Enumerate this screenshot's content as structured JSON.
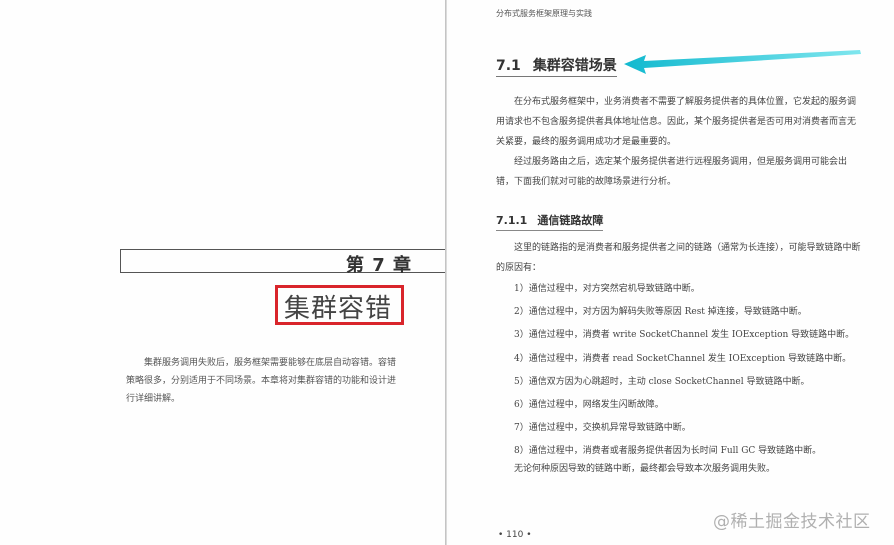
{
  "left_page": {
    "chapter_number": "第 7 章",
    "chapter_title": "集群容错",
    "intro": "集群服务调用失败后，服务框架需要能够在底层自动容错。容错策略很多，分别适用于不同场景。本章将对集群容错的功能和设计进行详细讲解。"
  },
  "right_page": {
    "running_head": "分布式服务框架原理与实践",
    "section": {
      "number": "7.1",
      "title": "集群容错场景"
    },
    "paragraphs": [
      "在分布式服务框架中，业务消费者不需要了解服务提供者的具体位置，它发起的服务调用请求也不包含服务提供者具体地址信息。因此，某个服务提供者是否可用对消费者而言无关紧要，最终的服务调用成功才是最重要的。",
      "经过服务路由之后，选定某个服务提供者进行远程服务调用，但是服务调用可能会出错，下面我们就对可能的故障场景进行分析。"
    ],
    "subsection": {
      "number": "7.1.1",
      "title": "通信链路故障"
    },
    "subsection_intro": "这里的链路指的是消费者和服务提供者之间的链路（通常为长连接），可能导致链路中断的原因有：",
    "reasons": [
      "1）通信过程中，对方突然宕机导致链路中断。",
      "2）通信过程中，对方因为解码失败等原因 Rest 掉连接，导致链路中断。",
      "3）通信过程中，消费者 write SocketChannel 发生 IOException 导致链路中断。",
      "4）通信过程中，消费者 read SocketChannel 发生 IOException 导致链路中断。",
      "5）通信双方因为心跳超时，主动 close SocketChannel 导致链路中断。",
      "6）通信过程中，网络发生闪断故障。",
      "7）通信过程中，交换机异常导致链路中断。",
      "8）通信过程中，消费者或者服务提供者因为长时间 Full GC 导致链路中断。"
    ],
    "conclusion": "无论何种原因导致的链路中断，最终都会导致本次服务调用失败。",
    "page_number": "• 110 •"
  },
  "watermark": "@稀土掘金技术社区",
  "colors": {
    "highlight_box": "#d9252b",
    "arrow": "#1cc6d6"
  }
}
